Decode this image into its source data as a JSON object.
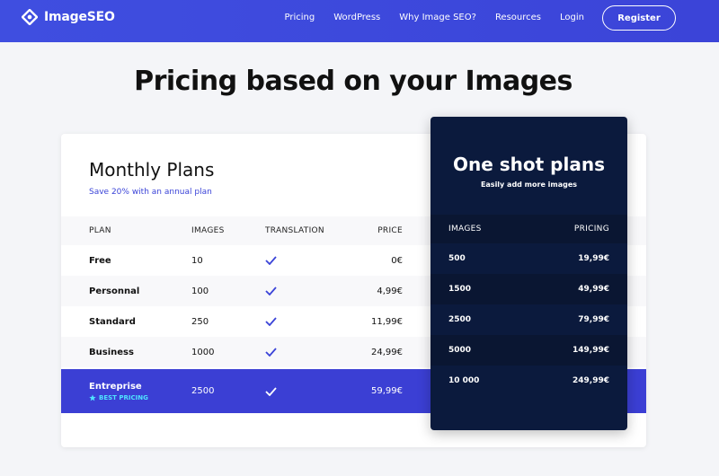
{
  "nav": {
    "brand": "ImageSEO",
    "links": [
      "Pricing",
      "WordPress",
      "Why Image SEO?",
      "Resources",
      "Login"
    ],
    "register_label": "Register"
  },
  "page_title": "Pricing based on your Images",
  "monthly": {
    "title": "Monthly Plans",
    "subtitle": "Save 20% with an annual plan",
    "columns": [
      "PLAN",
      "IMAGES",
      "TRANSLATION",
      "PRICE"
    ],
    "rows": [
      {
        "plan": "Free",
        "images": "10",
        "translation": true,
        "price": "0€"
      },
      {
        "plan": "Personnal",
        "images": "100",
        "translation": true,
        "price": "4,99€"
      },
      {
        "plan": "Standard",
        "images": "250",
        "translation": true,
        "price": "11,99€"
      },
      {
        "plan": "Business",
        "images": "1000",
        "translation": true,
        "price": "24,99€"
      },
      {
        "plan": "Entreprise",
        "images": "2500",
        "translation": true,
        "price": "59,99€",
        "badge": "BEST PRICING"
      }
    ]
  },
  "oneshot": {
    "title": "One shot plans",
    "subtitle": "Easily add more images",
    "columns": [
      "IMAGES",
      "PRICING"
    ],
    "rows": [
      {
        "images": "500",
        "pricing": "19,99€"
      },
      {
        "images": "1500",
        "pricing": "49,99€"
      },
      {
        "images": "2500",
        "pricing": "79,99€"
      },
      {
        "images": "5000",
        "pricing": "149,99€"
      },
      {
        "images": "10 000",
        "pricing": "249,99€"
      }
    ]
  },
  "colors": {
    "brand": "#3b44d8",
    "oneshot_bg": "#0b1a3d",
    "best_badge": "#4fe3ff"
  },
  "icons": {
    "logo": "imageseo-logo-icon",
    "check": "check-icon",
    "star": "star-icon"
  }
}
